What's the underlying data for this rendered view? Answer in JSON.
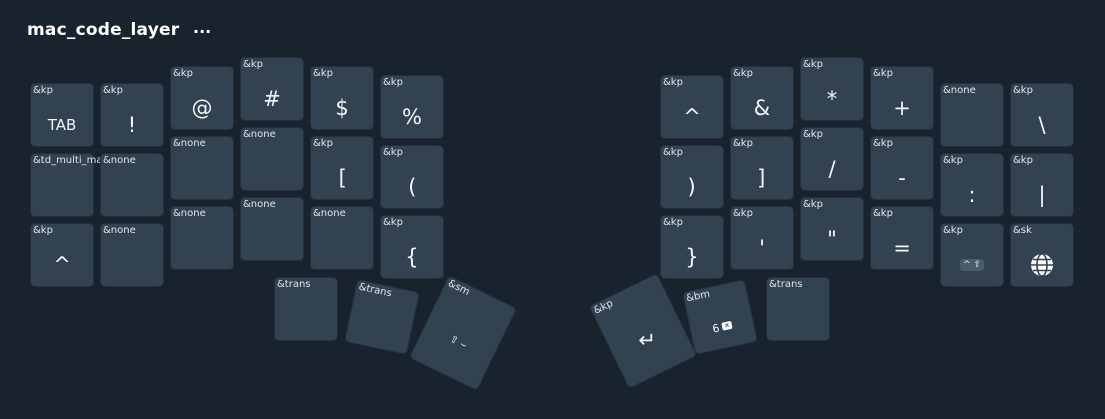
{
  "layer": {
    "title": "mac_code_layer",
    "menu": "···"
  },
  "keys": [
    {
      "id": "l0c0",
      "binding": "&kp",
      "label": "TAB"
    },
    {
      "id": "l0c1",
      "binding": "&kp",
      "label": "!"
    },
    {
      "id": "l0c2",
      "binding": "&kp",
      "label": "@"
    },
    {
      "id": "l0c3",
      "binding": "&kp",
      "label": "#"
    },
    {
      "id": "l0c4",
      "binding": "&kp",
      "label": "$"
    },
    {
      "id": "l0c5",
      "binding": "&kp",
      "label": "%"
    },
    {
      "id": "r0c0",
      "binding": "&kp",
      "label": "^"
    },
    {
      "id": "r0c1",
      "binding": "&kp",
      "label": "&"
    },
    {
      "id": "r0c2",
      "binding": "&kp",
      "label": "*"
    },
    {
      "id": "r0c3",
      "binding": "&kp",
      "label": "+"
    },
    {
      "id": "r0c4",
      "binding": "&none",
      "label": ""
    },
    {
      "id": "r0c5",
      "binding": "&kp",
      "label": "\\"
    },
    {
      "id": "l1c0",
      "binding": "&td_multi_ma",
      "label": ""
    },
    {
      "id": "l1c1",
      "binding": "&none",
      "label": ""
    },
    {
      "id": "l1c2",
      "binding": "&none",
      "label": ""
    },
    {
      "id": "l1c3",
      "binding": "&none",
      "label": ""
    },
    {
      "id": "l1c4",
      "binding": "&kp",
      "label": "["
    },
    {
      "id": "l1c5",
      "binding": "&kp",
      "label": "("
    },
    {
      "id": "r1c0",
      "binding": "&kp",
      "label": ")"
    },
    {
      "id": "r1c1",
      "binding": "&kp",
      "label": "]"
    },
    {
      "id": "r1c2",
      "binding": "&kp",
      "label": "/"
    },
    {
      "id": "r1c3",
      "binding": "&kp",
      "label": "-"
    },
    {
      "id": "r1c4",
      "binding": "&kp",
      "label": ":"
    },
    {
      "id": "r1c5",
      "binding": "&kp",
      "label": "|"
    },
    {
      "id": "l2c0",
      "binding": "&kp",
      "label": "^"
    },
    {
      "id": "l2c1",
      "binding": "&none",
      "label": ""
    },
    {
      "id": "l2c2",
      "binding": "&none",
      "label": ""
    },
    {
      "id": "l2c3",
      "binding": "&none",
      "label": ""
    },
    {
      "id": "l2c4",
      "binding": "&none",
      "label": ""
    },
    {
      "id": "l2c5",
      "binding": "&kp",
      "label": "{"
    },
    {
      "id": "r2c0",
      "binding": "&kp",
      "label": "}"
    },
    {
      "id": "r2c1",
      "binding": "&kp",
      "label": "'"
    },
    {
      "id": "r2c2",
      "binding": "&kp",
      "label": "\""
    },
    {
      "id": "r2c3",
      "binding": "&kp",
      "label": "="
    },
    {
      "id": "r2c4",
      "binding": "&kp",
      "label": "^",
      "sub": "⇧"
    },
    {
      "id": "r2c5",
      "binding": "&sk",
      "label": "",
      "icon": "globe-icon"
    },
    {
      "id": "lt0",
      "binding": "&trans",
      "label": ""
    },
    {
      "id": "lt1",
      "binding": "&trans",
      "label": ""
    },
    {
      "id": "lt2",
      "binding": "&sm",
      "label": "⇧ ⌣"
    },
    {
      "id": "rt0",
      "binding": "&kp",
      "label": "↵",
      "icon": "return-icon"
    },
    {
      "id": "rt1",
      "binding": "&bm",
      "label": "6",
      "tag": "✕",
      "icon": "backspace-icon"
    },
    {
      "id": "rt2",
      "binding": "&trans",
      "label": ""
    }
  ]
}
